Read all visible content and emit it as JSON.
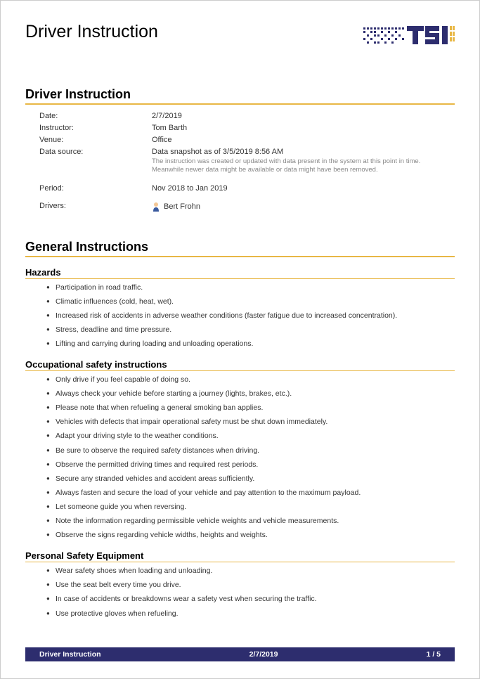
{
  "header": {
    "title": "Driver Instruction"
  },
  "section1": {
    "title": "Driver Instruction",
    "rows": {
      "date_label": "Date:",
      "date_value": "2/7/2019",
      "instructor_label": "Instructor:",
      "instructor_value": "Tom Barth",
      "venue_label": "Venue:",
      "venue_value": "Office",
      "datasource_label": "Data source:",
      "datasource_value": "Data snapshot as of 3/5/2019 8:56 AM",
      "datasource_note": "The instruction was created or updated with data present in the system at this point in time. Meanwhile newer data might be available or data might have been removed.",
      "period_label": "Period:",
      "period_value": "Nov 2018 to Jan 2019",
      "drivers_label": "Drivers:",
      "drivers_value": "Bert Frohn"
    }
  },
  "section2": {
    "title": "General Instructions",
    "hazards": {
      "title": "Hazards",
      "items": [
        "Participation in road traffic.",
        "Climatic influences (cold, heat, wet).",
        "Increased risk of accidents in adverse weather conditions (faster fatigue due to increased concentration).",
        "Stress, deadline and time pressure.",
        "Lifting and carrying during loading and unloading operations."
      ]
    },
    "safety": {
      "title": "Occupational safety instructions",
      "items": [
        "Only drive if you feel capable of doing so.",
        "Always check your vehicle before starting a journey (lights, brakes, etc.).",
        "Please note that when refueling a general smoking ban applies.",
        "Vehicles with defects that impair operational safety must be shut down immediately.",
        "Adapt your driving style to the weather conditions.",
        "Be sure to observe the required safety distances when driving.",
        "Observe the permitted driving times and required rest periods.",
        "Secure any stranded vehicles and accident areas sufficiently.",
        "Always fasten and secure the load of your vehicle and pay attention to the maximum payload.",
        "Let someone guide you when reversing.",
        "Note the information regarding permissible vehicle weights and vehicle measurements.",
        "Observe the signs regarding vehicle widths, heights and weights."
      ]
    },
    "pse": {
      "title": "Personal Safety Equipment",
      "items": [
        "Wear safety shoes when loading and unloading.",
        "Use the seat belt every time you drive.",
        "In case of accidents or breakdowns wear a safety vest when securing the traffic.",
        "Use protective gloves when refueling."
      ]
    }
  },
  "footer": {
    "left": "Driver Instruction",
    "center": "2/7/2019",
    "right": "1 / 5"
  }
}
